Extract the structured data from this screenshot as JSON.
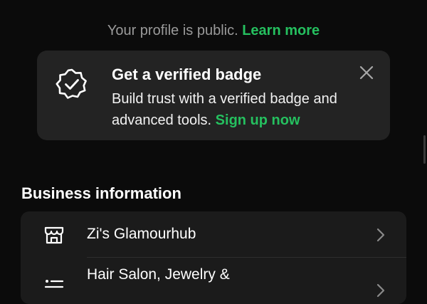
{
  "profile_notice": {
    "text": "Your profile is public.",
    "link_label": "Learn more"
  },
  "verified_banner": {
    "icon": "verified-badge-icon",
    "title": "Get a verified badge",
    "description": "Build trust with a verified badge and advanced tools.",
    "link_label": "Sign up now",
    "close_icon": "close-icon"
  },
  "business_info": {
    "section_title": "Business information",
    "rows": [
      {
        "icon": "storefront-icon",
        "label": "Zi's Glamourhub"
      },
      {
        "icon": "category-list-icon",
        "label": "Hair Salon, Jewelry &"
      }
    ]
  },
  "colors": {
    "background": "#0b0b0b",
    "card": "#232323",
    "accent_green": "#25c05f",
    "muted_text": "#9a9a9a"
  }
}
